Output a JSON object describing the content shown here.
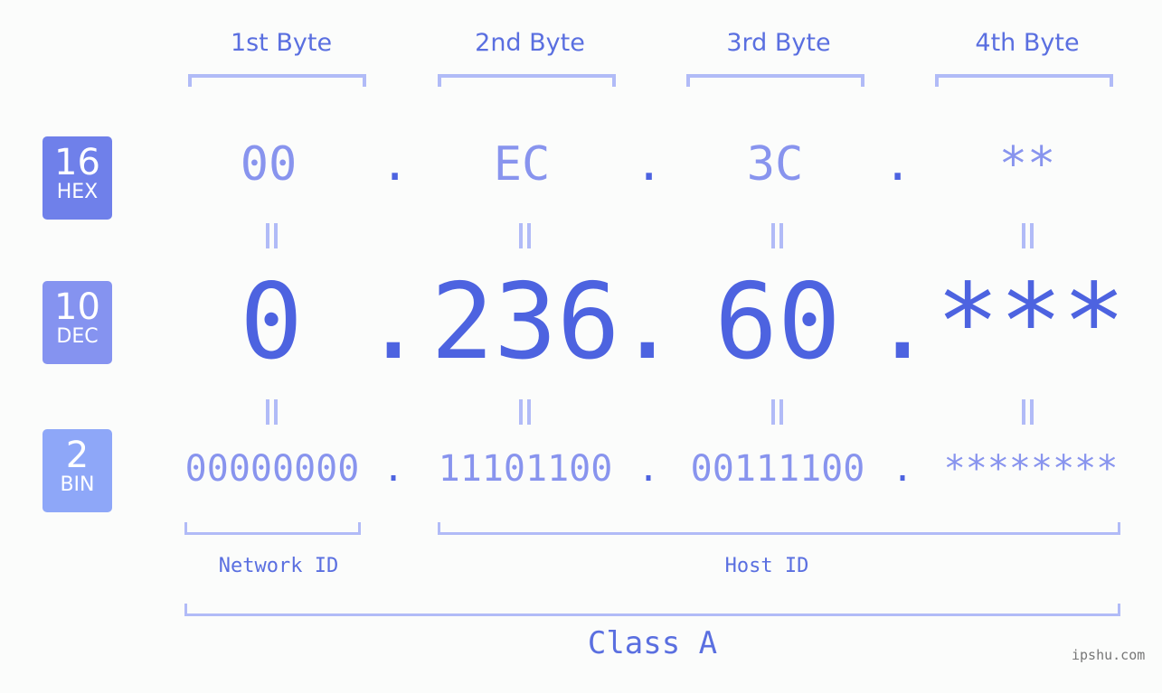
{
  "byte_headers": [
    "1st Byte",
    "2nd Byte",
    "3rd Byte",
    "4th Byte"
  ],
  "badges": [
    {
      "num": "16",
      "label": "HEX",
      "color": "#6f80ea"
    },
    {
      "num": "10",
      "label": "DEC",
      "color": "#8593f0"
    },
    {
      "num": "2",
      "label": "BIN",
      "color": "#8ea7f8"
    }
  ],
  "hex": [
    "00",
    "EC",
    "3C",
    "**"
  ],
  "dec": [
    "0",
    "236",
    "60",
    "***"
  ],
  "bin": [
    "00000000",
    "11101100",
    "00111100",
    "********"
  ],
  "separator": ".",
  "network_label": "Network ID",
  "host_label": "Host ID",
  "class_label": "Class A",
  "watermark": "ipshu.com"
}
